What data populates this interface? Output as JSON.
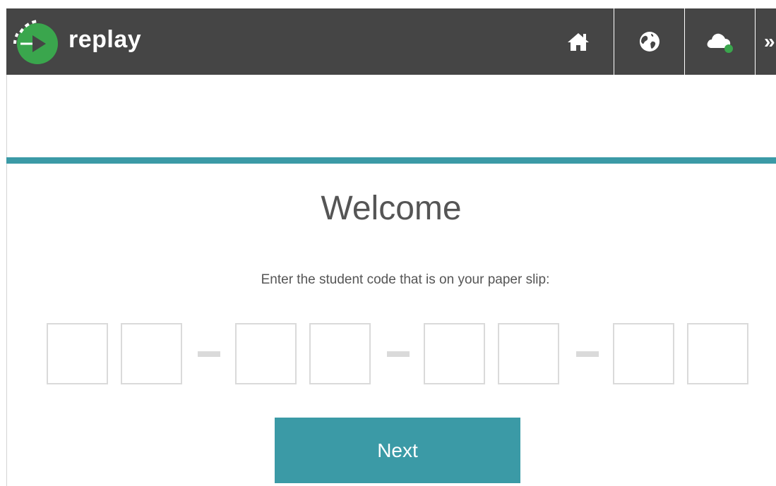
{
  "app": {
    "brand_name": "replay",
    "accent_color": "#3aa64d",
    "teal_color": "#3b9aa6"
  },
  "nav": {
    "icons": [
      "home-icon",
      "globe-icon",
      "cloud-status-icon"
    ],
    "more_label": "»",
    "cloud_status_color": "#3aa64d"
  },
  "main": {
    "title": "Welcome",
    "instruction": "Enter the student code that is on your paper slip:",
    "code": {
      "groups": 4,
      "digits_per_group": 2,
      "values": [
        "",
        "",
        "",
        "",
        "",
        "",
        "",
        ""
      ],
      "separator": "-"
    },
    "next_label": "Next"
  }
}
